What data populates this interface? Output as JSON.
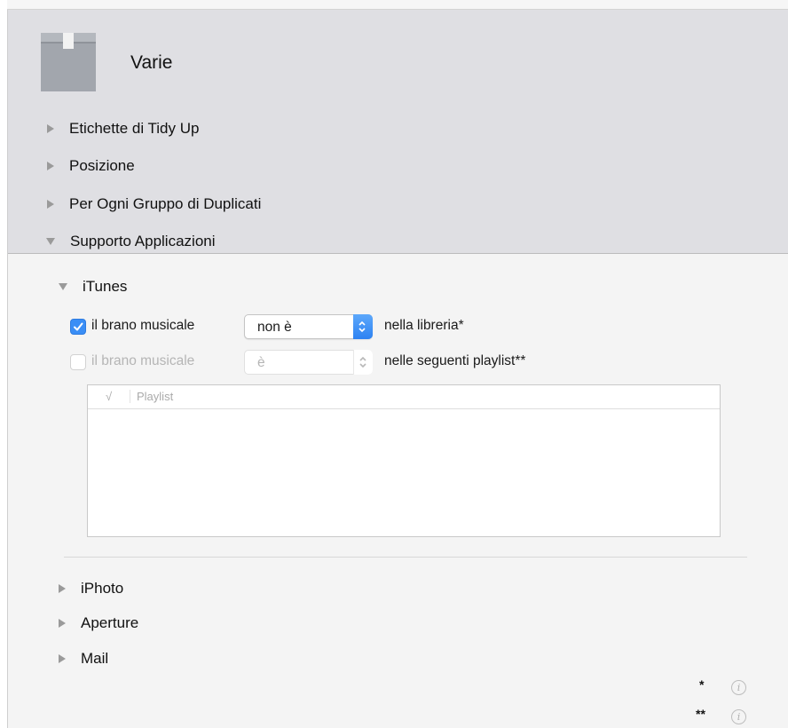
{
  "header": {
    "section_title": "Varie",
    "icon": "box-icon",
    "items": [
      {
        "label": "Etichette di Tidy Up",
        "expanded": false
      },
      {
        "label": "Posizione",
        "expanded": false
      },
      {
        "label": "Per Ogni Gruppo di Duplicati",
        "expanded": false
      },
      {
        "label": "Supporto Applicazioni",
        "expanded": true
      }
    ]
  },
  "itunes": {
    "label": "iTunes",
    "expanded": true,
    "rule1": {
      "checked": true,
      "label": "il brano musicale",
      "operator": "non è",
      "suffix": "nella libreria*"
    },
    "rule2": {
      "checked": false,
      "label": "il brano musicale",
      "operator": "è",
      "suffix": "nelle seguenti playlist**"
    },
    "table": {
      "columns": [
        "√",
        "Playlist"
      ],
      "rows": []
    }
  },
  "other_apps": [
    {
      "label": "iPhoto",
      "expanded": false
    },
    {
      "label": "Aperture",
      "expanded": false
    },
    {
      "label": "Mail",
      "expanded": false
    }
  ],
  "notes": [
    {
      "mark": "*",
      "icon": "info-icon"
    },
    {
      "mark": "**",
      "icon": "info-icon"
    }
  ],
  "colors": {
    "accent": "#3a8ef6",
    "header_bg": "#dfdfe3",
    "panel_bg": "#f4f4f4"
  }
}
